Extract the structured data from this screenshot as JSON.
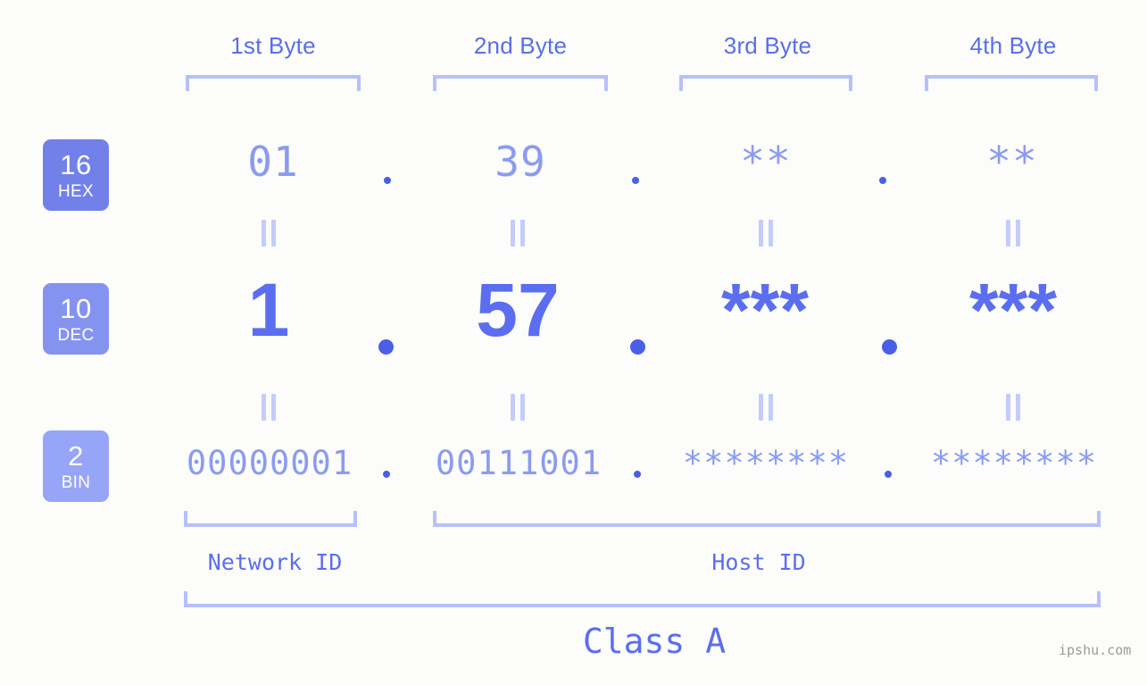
{
  "background_color": "#fcfdfa",
  "accent_color": "#5b6ef0",
  "bracket_color": "#b6c0fb",
  "headers": {
    "byte1": "1st Byte",
    "byte2": "2nd Byte",
    "byte3": "3rd Byte",
    "byte4": "4th Byte"
  },
  "bases": {
    "hex": {
      "num": "16",
      "label": "HEX",
      "color": "#7280ea"
    },
    "dec": {
      "num": "10",
      "label": "DEC",
      "color": "#8593f0"
    },
    "bin": {
      "num": "2",
      "label": "BIN",
      "color": "#96a5f7"
    }
  },
  "rows": {
    "hex": {
      "b1": "01",
      "b2": "39",
      "b3": "**",
      "b4": "**"
    },
    "dec": {
      "b1": "1",
      "b2": "57",
      "b3": "***",
      "b4": "***"
    },
    "bin": {
      "b1": "00000001",
      "b2": "00111001",
      "b3": "********",
      "b4": "********"
    }
  },
  "separator": ".",
  "equals_glyph": "=",
  "footer": {
    "network_id": "Network ID",
    "host_id": "Host ID",
    "class": "Class A",
    "watermark": "ipshu.com"
  }
}
